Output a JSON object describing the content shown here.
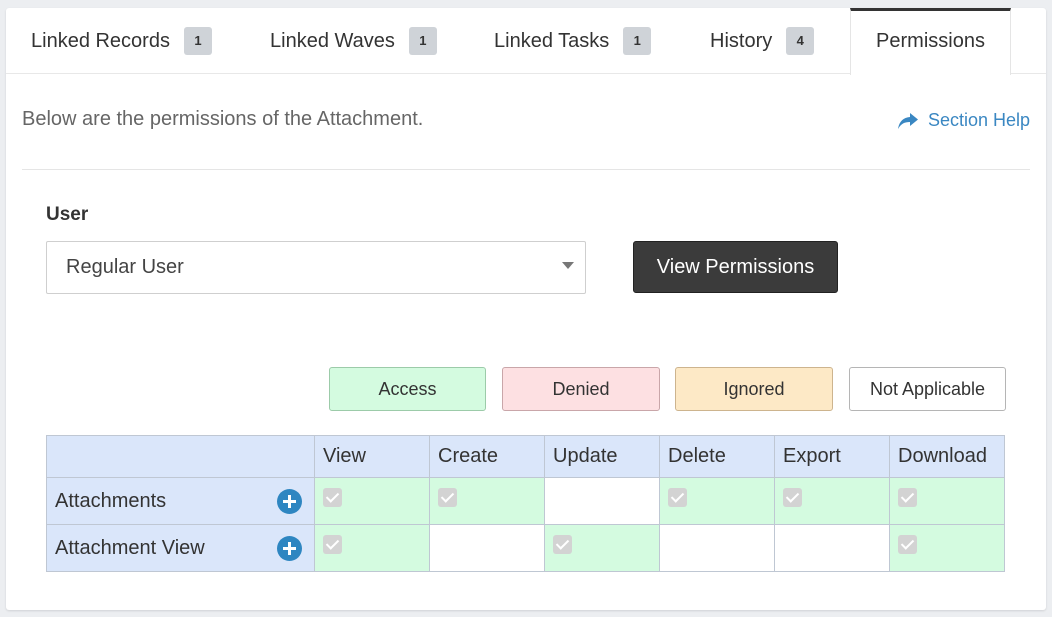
{
  "tabs": [
    {
      "label": "Linked Records",
      "badge": "1"
    },
    {
      "label": "Linked Waves",
      "badge": "1"
    },
    {
      "label": "Linked Tasks",
      "badge": "1"
    },
    {
      "label": "History",
      "badge": "4"
    },
    {
      "label": "Permissions",
      "active": true
    }
  ],
  "description": "Below are the permissions of the Attachment.",
  "section_help": "Section Help",
  "user": {
    "label": "User",
    "selected": "Regular User"
  },
  "view_permissions_button": "View Permissions",
  "legend": {
    "access": "Access",
    "denied": "Denied",
    "ignored": "Ignored",
    "not_applicable": "Not Applicable"
  },
  "colors": {
    "access": "#d4fbe0",
    "denied": "#fde0e2",
    "ignored": "#fde9c6",
    "not_applicable": "#ffffff",
    "header": "#dae6fa",
    "link": "#3a87c2"
  },
  "table": {
    "columns": [
      "View",
      "Create",
      "Update",
      "Delete",
      "Export",
      "Download"
    ],
    "rows": [
      {
        "name": "Attachments",
        "cells": [
          "access",
          "access",
          "none",
          "access",
          "access",
          "access"
        ]
      },
      {
        "name": "Attachment View",
        "cells": [
          "access",
          "none",
          "access",
          "none",
          "none",
          "access"
        ]
      }
    ]
  }
}
